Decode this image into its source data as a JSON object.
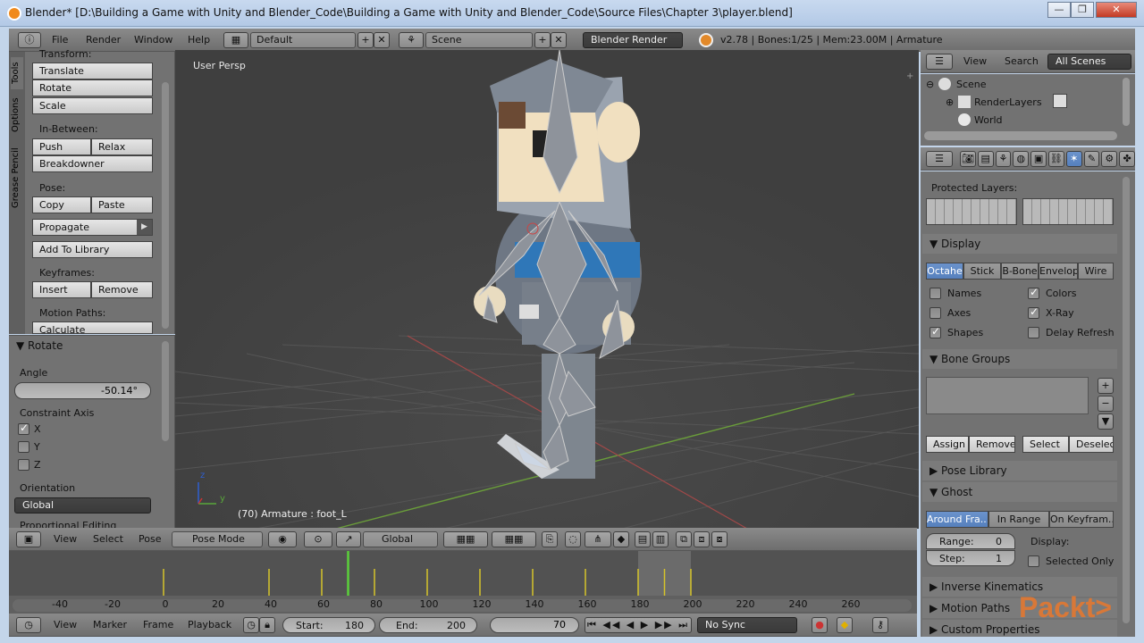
{
  "window": {
    "title": "Blender* [D:\\Building a Game with Unity and Blender_Code\\Building a Game with Unity and Blender_Code\\Source Files\\Chapter 3\\player.blend]",
    "min": "—",
    "max": "❐",
    "close": "✕"
  },
  "info_header": {
    "menus": [
      "File",
      "Render",
      "Window",
      "Help"
    ],
    "screen_layout": "Default",
    "scene": "Scene",
    "engine": "Blender Render",
    "stats": "v2.78 | Bones:1/25  | Mem:23.00M | Armature"
  },
  "toolshelf": {
    "side_tabs": [
      "Tools",
      "Options",
      "Grease Pencil"
    ],
    "transform_header": "Transform:",
    "transform": [
      "Translate",
      "Rotate",
      "Scale"
    ],
    "inbetween_header": "In-Between:",
    "push": "Push",
    "relax": "Relax",
    "breakdowner": "Breakdowner",
    "pose_header": "Pose:",
    "copy": "Copy",
    "paste": "Paste",
    "propagate": "Propagate",
    "add_to_library": "Add To Library",
    "keyframes_header": "Keyframes:",
    "insert": "Insert",
    "remove": "Remove",
    "motion_header": "Motion Paths:",
    "calculate": "Calculate"
  },
  "operator": {
    "title": "Rotate",
    "angle_label": "Angle",
    "angle_value": "-50.14°",
    "constraint_label": "Constraint Axis",
    "axes": [
      {
        "label": "X",
        "checked": true
      },
      {
        "label": "Y",
        "checked": false
      },
      {
        "label": "Z",
        "checked": false
      }
    ],
    "orientation_label": "Orientation",
    "orientation_value": "Global",
    "proportional": "Proportional Editing"
  },
  "viewport": {
    "view_name": "User Persp",
    "status": "(70) Armature : foot_L",
    "axis_x": "y",
    "axis_z": "z"
  },
  "view_header": {
    "menus": [
      "View",
      "Select",
      "Pose"
    ],
    "mode": "Pose Mode",
    "orientation": "Global"
  },
  "outliner": {
    "menus": [
      "View",
      "Search"
    ],
    "filter": "All Scenes",
    "items": [
      "Scene",
      "RenderLayers",
      "World"
    ]
  },
  "properties": {
    "protected_layers": "Protected Layers:",
    "display": {
      "title": "Display",
      "tabs": [
        "Octahe",
        "Stick",
        "B-Bone",
        "Envelop",
        "Wire"
      ],
      "selected_tab": "Octahe",
      "options": [
        {
          "label": "Names",
          "checked": false
        },
        {
          "label": "Colors",
          "checked": true
        },
        {
          "label": "Axes",
          "checked": false
        },
        {
          "label": "X-Ray",
          "checked": true
        },
        {
          "label": "Shapes",
          "checked": true
        },
        {
          "label": "Delay Refresh",
          "checked": false
        }
      ]
    },
    "bone_groups": {
      "title": "Bone Groups",
      "buttons": [
        "Assign",
        "Remove",
        "Select",
        "Deselect"
      ]
    },
    "pose_library": "Pose Library",
    "ghost": {
      "title": "Ghost",
      "tabs": [
        "Around Fra...",
        "In Range",
        "On Keyfram..."
      ],
      "range_label": "Range:",
      "range_value": "0",
      "step_label": "Step:",
      "step_value": "1",
      "display_label": "Display:",
      "selected_only": "Selected Only"
    },
    "inverse_kinematics": "Inverse Kinematics",
    "motion_paths": "Motion Paths",
    "custom_properties": "Custom Properties"
  },
  "timeline": {
    "ruler": [
      "-40",
      "-20",
      "0",
      "20",
      "40",
      "60",
      "80",
      "100",
      "120",
      "140",
      "160",
      "180",
      "200",
      "220",
      "240",
      "260"
    ],
    "markers": [
      0,
      40,
      60,
      80,
      100,
      120,
      140,
      160,
      180,
      190,
      200
    ],
    "current_frame": 70,
    "preview_range": [
      180,
      200
    ]
  },
  "timeline_header": {
    "menus": [
      "View",
      "Marker",
      "Frame",
      "Playback"
    ],
    "start_label": "Start:",
    "start": "180",
    "end_label": "End:",
    "end": "200",
    "current": "70",
    "sync": "No Sync"
  },
  "watermark": {
    "text": "Packt>"
  }
}
